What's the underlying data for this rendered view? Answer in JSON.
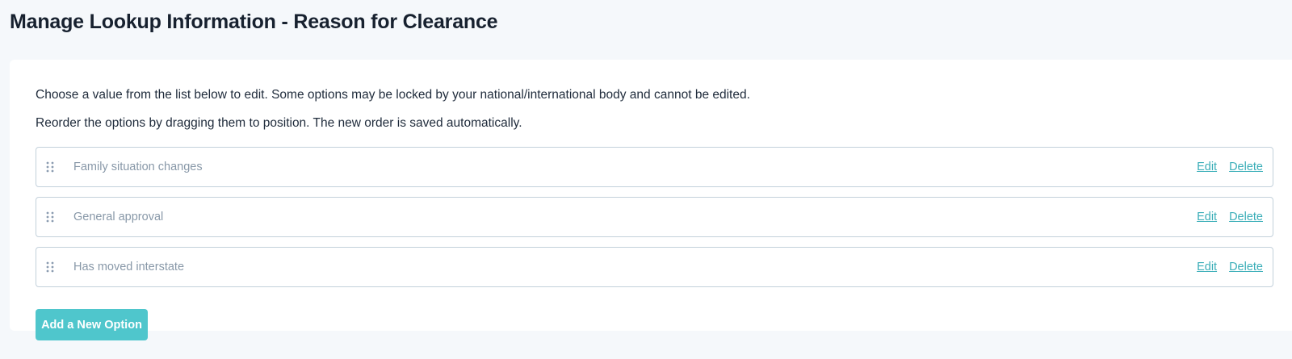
{
  "page": {
    "title": "Manage Lookup Information - Reason for Clearance"
  },
  "instructions": {
    "line1": "Choose a value from the list below to edit. Some options may be locked by your national/international body and cannot be edited.",
    "line2": "Reorder the options by dragging them to position. The new order is saved automatically."
  },
  "options": [
    {
      "label": "Family situation changes",
      "edit_label": "Edit",
      "delete_label": "Delete"
    },
    {
      "label": "General approval",
      "edit_label": "Edit",
      "delete_label": "Delete"
    },
    {
      "label": "Has moved interstate",
      "edit_label": "Edit",
      "delete_label": "Delete"
    }
  ],
  "icons": {
    "row_handle": "drag-handle-icon"
  },
  "actions": {
    "add_option_label": "Add a New Option"
  },
  "colors": {
    "accent": "#4fc6cc",
    "link": "#3aaeb8",
    "page_background": "#f5f8fb",
    "row_border": "#c3d1db"
  }
}
